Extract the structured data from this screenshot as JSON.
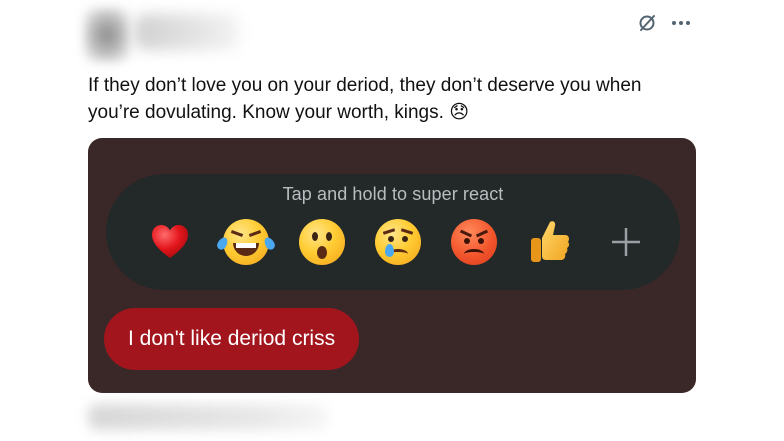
{
  "post": {
    "text": "If they don’t love you on your deriod, they don’t deserve you when you’re dovulating. Know your worth, kings.",
    "text_emoji": "😞"
  },
  "header": {
    "icons": [
      "grok-slash-icon",
      "more-icon"
    ]
  },
  "media": {
    "react_title": "Tap and hold to super react",
    "reactions": [
      "heart-icon",
      "laughing-tears-icon",
      "surprised-face-icon",
      "crying-face-icon",
      "angry-face-icon",
      "thumbs-up-icon",
      "plus-icon"
    ],
    "message": "I don't like deriod criss",
    "colors": {
      "card_bg": "#3a2828",
      "pill_bg": "#232829",
      "bubble_bg": "#a3151d"
    }
  }
}
